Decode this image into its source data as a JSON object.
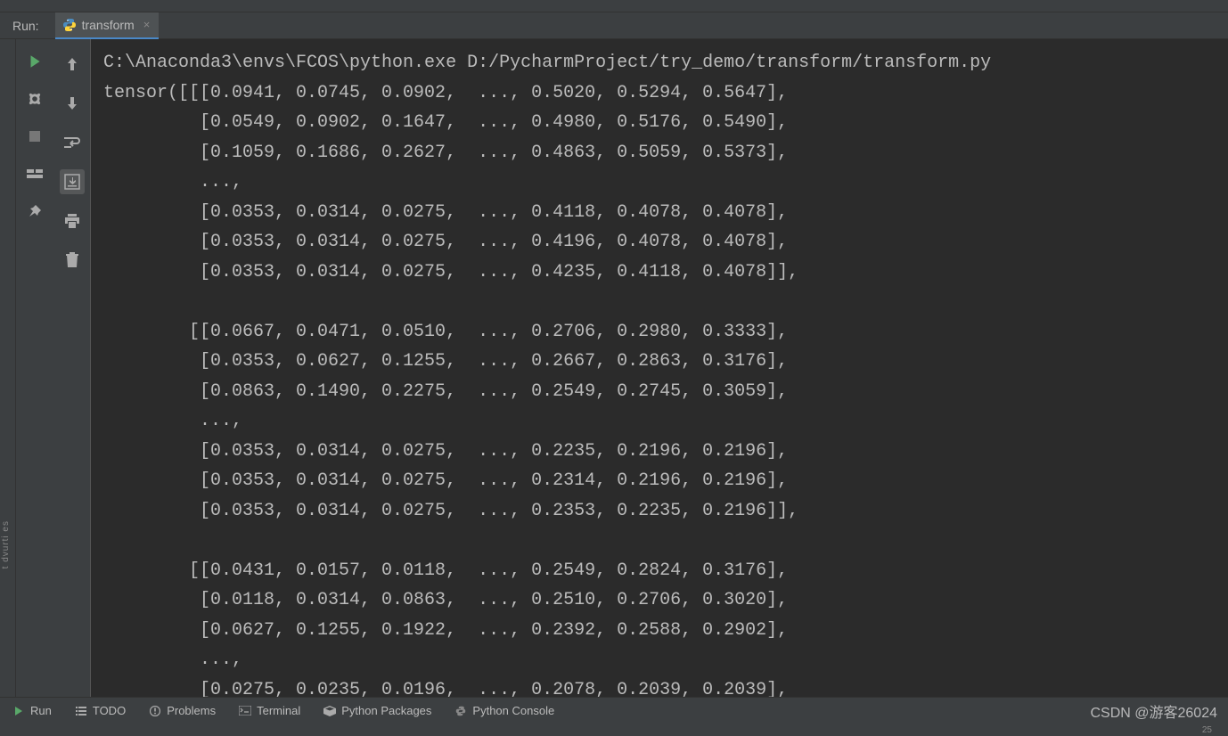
{
  "header": {
    "run_label": "Run:"
  },
  "tab": {
    "name": "transform",
    "close_glyph": "×"
  },
  "left_strip_text": "t dvurti es",
  "console_output": "C:\\Anaconda3\\envs\\FCOS\\python.exe D:/PycharmProject/try_demo/transform/transform.py\ntensor([[[0.0941, 0.0745, 0.0902,  ..., 0.5020, 0.5294, 0.5647],\n         [0.0549, 0.0902, 0.1647,  ..., 0.4980, 0.5176, 0.5490],\n         [0.1059, 0.1686, 0.2627,  ..., 0.4863, 0.5059, 0.5373],\n         ...,\n         [0.0353, 0.0314, 0.0275,  ..., 0.4118, 0.4078, 0.4078],\n         [0.0353, 0.0314, 0.0275,  ..., 0.4196, 0.4078, 0.4078],\n         [0.0353, 0.0314, 0.0275,  ..., 0.4235, 0.4118, 0.4078]],\n\n        [[0.0667, 0.0471, 0.0510,  ..., 0.2706, 0.2980, 0.3333],\n         [0.0353, 0.0627, 0.1255,  ..., 0.2667, 0.2863, 0.3176],\n         [0.0863, 0.1490, 0.2275,  ..., 0.2549, 0.2745, 0.3059],\n         ...,\n         [0.0353, 0.0314, 0.0275,  ..., 0.2235, 0.2196, 0.2196],\n         [0.0353, 0.0314, 0.0275,  ..., 0.2314, 0.2196, 0.2196],\n         [0.0353, 0.0314, 0.0275,  ..., 0.2353, 0.2235, 0.2196]],\n\n        [[0.0431, 0.0157, 0.0118,  ..., 0.2549, 0.2824, 0.3176],\n         [0.0118, 0.0314, 0.0863,  ..., 0.2510, 0.2706, 0.3020],\n         [0.0627, 0.1255, 0.1922,  ..., 0.2392, 0.2588, 0.2902],\n         ...,\n         [0.0275, 0.0235, 0.0196,  ..., 0.2078, 0.2039, 0.2039],",
  "bottom_bar": {
    "run": "Run",
    "todo": "TODO",
    "problems": "Problems",
    "terminal": "Terminal",
    "packages": "Python Packages",
    "console": "Python Console"
  },
  "status": {
    "right_num": "25"
  },
  "watermark": "CSDN @游客26024"
}
